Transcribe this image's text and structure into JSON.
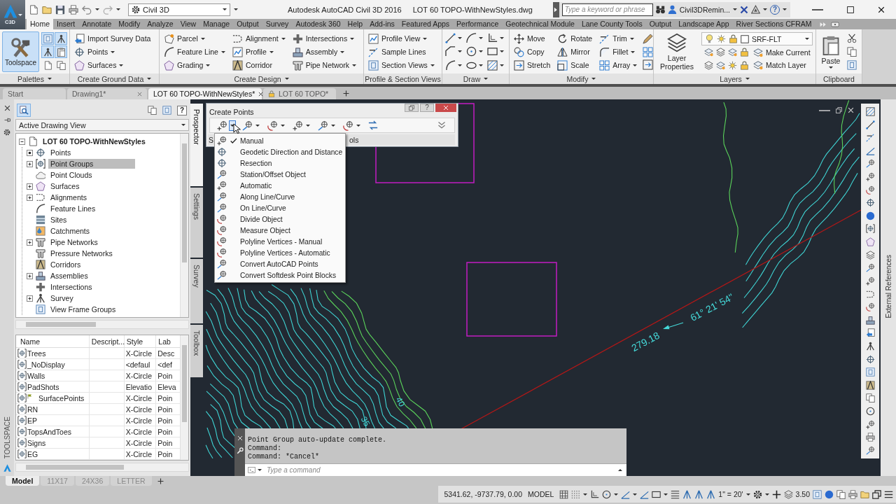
{
  "title_bar": {
    "app_badge": "C3D",
    "workspace": "Civil 3D",
    "app_title": "Autodesk AutoCAD Civil 3D 2016",
    "file_title": "LOT 60 TOPO-WithNewStyles.dwg",
    "search": {
      "placeholder": "Type a keyword or phrase"
    },
    "user": "Civil3DRemin...",
    "help": "?"
  },
  "ribbon": {
    "tabs": [
      {
        "label": "Home",
        "selected": true
      },
      {
        "label": "Insert",
        "selected": false
      },
      {
        "label": "Annotate",
        "selected": false
      },
      {
        "label": "Modify",
        "selected": false
      },
      {
        "label": "Analyze",
        "selected": false
      },
      {
        "label": "View",
        "selected": false
      },
      {
        "label": "Manage",
        "selected": false
      },
      {
        "label": "Output",
        "selected": false
      },
      {
        "label": "Survey",
        "selected": false
      },
      {
        "label": "Autodesk 360",
        "selected": false
      },
      {
        "label": "Help",
        "selected": false
      },
      {
        "label": "Add-ins",
        "selected": false
      },
      {
        "label": "Featured Apps",
        "selected": false
      },
      {
        "label": "Performance",
        "selected": false
      },
      {
        "label": "Geotechnical Module",
        "selected": false
      },
      {
        "label": "Lane County Tools",
        "selected": false
      },
      {
        "label": "Output",
        "selected": false
      },
      {
        "label": "Landscape App",
        "selected": false
      },
      {
        "label": "River Sections CFRAM",
        "selected": false
      }
    ],
    "panels": [
      {
        "kind": "palettes",
        "title": "Palettes",
        "menu": true,
        "big": {
          "label": "Toolspace",
          "selected": true
        },
        "toggles": [
          {
            "on": true
          },
          {
            "on": true
          },
          {
            "on": true
          },
          {
            "on": true
          },
          {
            "on": false
          },
          {
            "on": false
          }
        ]
      },
      {
        "kind": "ground",
        "title": "Create Ground Data",
        "menu": true,
        "columns": [
          [
            {
              "label": "Import Survey Data",
              "menu": false
            },
            {
              "label": "Points",
              "menu": true
            },
            {
              "label": "Surfaces",
              "menu": true
            }
          ]
        ]
      },
      {
        "kind": "design",
        "title": "Create Design",
        "menu": true,
        "columns": [
          [
            {
              "label": "Parcel",
              "menu": true
            },
            {
              "label": "Feature Line",
              "menu": true
            },
            {
              "label": "Grading",
              "menu": true
            }
          ],
          [
            {
              "label": "Alignment",
              "menu": true
            },
            {
              "label": "Profile",
              "menu": true
            },
            {
              "label": "Corridor",
              "menu": false
            }
          ],
          [
            {
              "label": "Intersections",
              "menu": true
            },
            {
              "label": "Assembly",
              "menu": true
            },
            {
              "label": "Pipe Network",
              "menu": true
            }
          ]
        ]
      },
      {
        "kind": "views",
        "title": "Profile & Section Views",
        "menu": false,
        "columns": [
          [
            {
              "label": "Profile View",
              "menu": true
            },
            {
              "label": "Sample Lines",
              "menu": false
            },
            {
              "label": "Section Views",
              "menu": true
            }
          ]
        ]
      },
      {
        "kind": "draw",
        "title": "Draw",
        "menu": true
      },
      {
        "kind": "modify",
        "title": "Modify",
        "menu": true,
        "columns": [
          [
            {
              "label": "Move",
              "menu": false
            },
            {
              "label": "Copy",
              "menu": false
            },
            {
              "label": "Stretch",
              "menu": false
            }
          ],
          [
            {
              "label": "Rotate",
              "menu": false
            },
            {
              "label": "Mirror",
              "menu": false
            },
            {
              "label": "Scale",
              "menu": false
            }
          ],
          [
            {
              "label": "Trim",
              "menu": true
            },
            {
              "label": "Fillet",
              "menu": true
            },
            {
              "label": "Array",
              "menu": true
            }
          ]
        ]
      },
      {
        "kind": "layers",
        "title": "Layers",
        "menu": true,
        "big": {
          "label": "Layer Properties"
        },
        "current_layer": "SRF-FLT",
        "buttons": [
          {
            "label": "Make Current"
          },
          {
            "label": "Match Layer"
          }
        ]
      },
      {
        "kind": "clipboard",
        "title": "Clipboard",
        "menu": false,
        "big": {
          "label": "Paste",
          "menu": true
        }
      }
    ]
  },
  "file_tabs": [
    {
      "label": "Start",
      "selected": false,
      "closable": false,
      "read_only": false
    },
    {
      "label": "Drawing1*",
      "selected": false,
      "closable": true,
      "read_only": false
    },
    {
      "label": "LOT 60 TOPO-WithNewStyles*",
      "selected": true,
      "closable": true,
      "read_only": false
    },
    {
      "label": "LOT 60 TOPO*",
      "selected": false,
      "closable": false,
      "read_only": true
    }
  ],
  "toolspace": {
    "title": "TOOLSPACE",
    "help": "?",
    "view": "Active Drawing View",
    "tree": {
      "label": "LOT 60 TOPO-WithNewStyles",
      "expanded": true,
      "children": [
        {
          "label": "Points",
          "kind": "marked",
          "selected": false
        },
        {
          "label": "Point Groups",
          "kind": "branch",
          "selected": true
        },
        {
          "label": "Point Clouds",
          "kind": "leaf",
          "selected": false
        },
        {
          "label": "Surfaces",
          "kind": "branch",
          "selected": false
        },
        {
          "label": "Alignments",
          "kind": "branch",
          "selected": false
        },
        {
          "label": "Feature Lines",
          "kind": "leaf",
          "selected": false
        },
        {
          "label": "Sites",
          "kind": "leaf",
          "selected": false
        },
        {
          "label": "Catchments",
          "kind": "leaf",
          "selected": false
        },
        {
          "label": "Pipe Networks",
          "kind": "branch",
          "selected": false
        },
        {
          "label": "Pressure Networks",
          "kind": "leaf",
          "selected": false
        },
        {
          "label": "Corridors",
          "kind": "leaf",
          "selected": false
        },
        {
          "label": "Assemblies",
          "kind": "branch",
          "selected": false
        },
        {
          "label": "Intersections",
          "kind": "leaf",
          "selected": false
        },
        {
          "label": "Survey",
          "kind": "branch",
          "selected": false
        },
        {
          "label": "View Frame Groups",
          "kind": "leaf",
          "selected": false
        }
      ]
    },
    "table": {
      "columns": [
        "Name",
        "Descript...",
        "Style",
        "Lab"
      ],
      "rows": [
        {
          "name": "Trees",
          "style": "X-Circle",
          "label": "Desc",
          "flagged": false
        },
        {
          "name": "_NoDisplay",
          "style": "<defaul",
          "label": "<def",
          "flagged": false
        },
        {
          "name": "Walls",
          "style": "X-Circle",
          "label": "Poin",
          "flagged": false
        },
        {
          "name": "PadShots",
          "style": "Elevatio",
          "label": "Eleva",
          "flagged": false
        },
        {
          "name": "SurfacePoints",
          "style": "X-Circle",
          "label": "Poin",
          "flagged": true
        },
        {
          "name": "RN",
          "style": "X-Circle",
          "label": "Poin",
          "flagged": false
        },
        {
          "name": "EP",
          "style": "X-Circle",
          "label": "Poin",
          "flagged": false
        },
        {
          "name": "TopsAndToes",
          "style": "X-Circle",
          "label": "Poin",
          "flagged": false
        },
        {
          "name": "Signs",
          "style": "X-Circle",
          "label": "Poin",
          "flagged": false
        },
        {
          "name": "EG",
          "style": "X-Circle",
          "label": "Poin",
          "flagged": false
        }
      ]
    },
    "side_tabs": [
      {
        "label": "Prospector",
        "selected": true
      },
      {
        "label": "Settings",
        "selected": false
      },
      {
        "label": "Survey",
        "selected": false
      },
      {
        "label": "Toolbox",
        "selected": false
      }
    ]
  },
  "create_points": {
    "title": "Create Points",
    "help": "?",
    "tools": [
      {
        "open": true
      },
      {
        "open": false
      },
      {
        "open": false
      },
      {
        "open": false
      },
      {
        "open": false
      },
      {
        "open": false
      }
    ],
    "row_start": "S",
    "row_end": "ols",
    "menu": [
      {
        "label": "Manual",
        "checked": true
      },
      {
        "label": "Geodetic Direction and Distance",
        "checked": false
      },
      {
        "label": "Resection",
        "checked": false
      },
      {
        "label": "Station/Offset Object",
        "checked": false
      },
      {
        "label": "Automatic",
        "checked": false
      },
      {
        "label": "Along Line/Curve",
        "checked": false
      },
      {
        "label": "On Line/Curve",
        "checked": false
      },
      {
        "label": "Divide Object",
        "checked": false
      },
      {
        "label": "Measure Object",
        "checked": false
      },
      {
        "label": "Polyline Vertices - Manual",
        "checked": false
      },
      {
        "label": "Polyline Vertices - Automatic",
        "checked": false
      },
      {
        "label": "Convert AutoCAD Points",
        "checked": false
      },
      {
        "label": "Convert Softdesk Point Blocks",
        "checked": false
      }
    ]
  },
  "drawing": {
    "labels": [
      {
        "kind": "distance",
        "text": "279.18"
      },
      {
        "kind": "bearing",
        "text": "61° 21' 54\""
      },
      {
        "kind": "contour",
        "text": "40"
      },
      {
        "kind": "contour",
        "text": "35"
      }
    ]
  },
  "command_line": {
    "history": [
      "Point Group auto-update complete.",
      "Command:",
      "Command: *Cancel*"
    ],
    "input": {
      "placeholder": "Type a command"
    }
  },
  "right_rail": {
    "label": "External References"
  },
  "layout_tabs": [
    {
      "label": "Model",
      "selected": true
    },
    {
      "label": "11X17",
      "selected": false
    },
    {
      "label": "24X36",
      "selected": false
    },
    {
      "label": "LETTER",
      "selected": false
    }
  ],
  "status_bar": {
    "coordinates": "5341.62, -9737.79, 0.00",
    "space": "MODEL",
    "scale": "1\" = 20'",
    "weight": "3.50"
  }
}
